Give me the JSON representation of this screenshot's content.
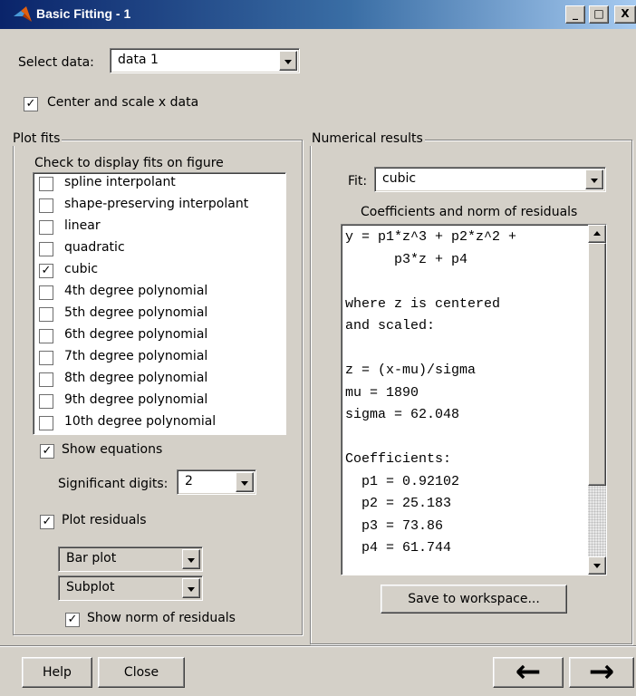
{
  "window": {
    "title": "Basic Fitting - 1",
    "min_label": "_",
    "max_label": "□",
    "close_label": "X"
  },
  "select_data": {
    "label": "Select data:",
    "value": "data 1"
  },
  "center_scale": {
    "label": "Center and scale x data",
    "checked": true
  },
  "plot_fits": {
    "title": "Plot fits",
    "instruction": "Check to display fits on figure",
    "items": [
      {
        "label": "spline interpolant",
        "checked": false
      },
      {
        "label": "shape-preserving interpolant",
        "checked": false
      },
      {
        "label": "linear",
        "checked": false
      },
      {
        "label": "quadratic",
        "checked": false
      },
      {
        "label": "cubic",
        "checked": true
      },
      {
        "label": "4th degree polynomial",
        "checked": false
      },
      {
        "label": "5th degree polynomial",
        "checked": false
      },
      {
        "label": "6th degree polynomial",
        "checked": false
      },
      {
        "label": "7th degree polynomial",
        "checked": false
      },
      {
        "label": "8th degree polynomial",
        "checked": false
      },
      {
        "label": "9th degree polynomial",
        "checked": false
      },
      {
        "label": "10th degree polynomial",
        "checked": false
      }
    ],
    "show_equations": {
      "label": "Show equations",
      "checked": true
    },
    "significant_digits": {
      "label": "Significant digits:",
      "value": "2"
    },
    "plot_residuals": {
      "label": "Plot residuals",
      "checked": true
    },
    "residual_plot_type": "Bar plot",
    "residual_location": "Subplot",
    "show_norm": {
      "label": "Show norm of residuals",
      "checked": true
    }
  },
  "numerical_results": {
    "title": "Numerical results",
    "fit_label": "Fit:",
    "fit_value": "cubic",
    "coeff_heading": "Coefficients and norm of residuals",
    "text": "y = p1*z^3 + p2*z^2 +\n      p3*z + p4\n\nwhere z is centered\nand scaled:\n\nz = (x-mu)/sigma\nmu = 1890\nsigma = 62.048\n\nCoefficients:\n  p1 = 0.92102\n  p2 = 25.183\n  p3 = 73.86\n  p4 = 61.744",
    "save_button": "Save to workspace..."
  },
  "footer": {
    "help_button": "Help",
    "close_button": "Close",
    "back_label": "←",
    "forward_label": "→"
  }
}
